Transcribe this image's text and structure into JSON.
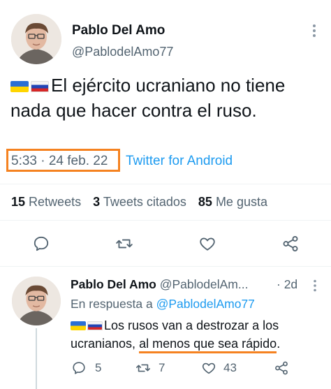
{
  "main_tweet": {
    "author_name": "Pablo Del Amo",
    "author_handle": "@PablodelAmo77",
    "text": "El ejército ucraniano no tiene nada que hacer contra el ruso.",
    "time_date": "5:33 · 24 feb. 22",
    "source": "Twitter for Android",
    "stats": {
      "retweets_count": "15",
      "retweets_label": "Retweets",
      "quotes_count": "3",
      "quotes_label": "Tweets citados",
      "likes_count": "85",
      "likes_label": "Me gusta"
    }
  },
  "reply_tweet": {
    "author_name": "Pablo Del Amo",
    "author_handle": "@PablodelAm...",
    "age": "· 2d",
    "reply_prefix": "En respuesta a",
    "reply_to": "@PablodelAmo77",
    "text_part1": "Los rusos van a destrozar a los ucranianos, ",
    "text_highlight": "al menos que sea rápido",
    "text_part2": ".",
    "actions": {
      "replies": "5",
      "retweets": "7",
      "likes": "43"
    }
  },
  "colors": {
    "link": "#1d9bf0",
    "highlight": "#f58220",
    "muted": "#536471",
    "divider": "#eff3f4"
  },
  "icons": [
    "more-icon",
    "reply-icon",
    "retweet-icon",
    "like-icon",
    "share-icon"
  ]
}
